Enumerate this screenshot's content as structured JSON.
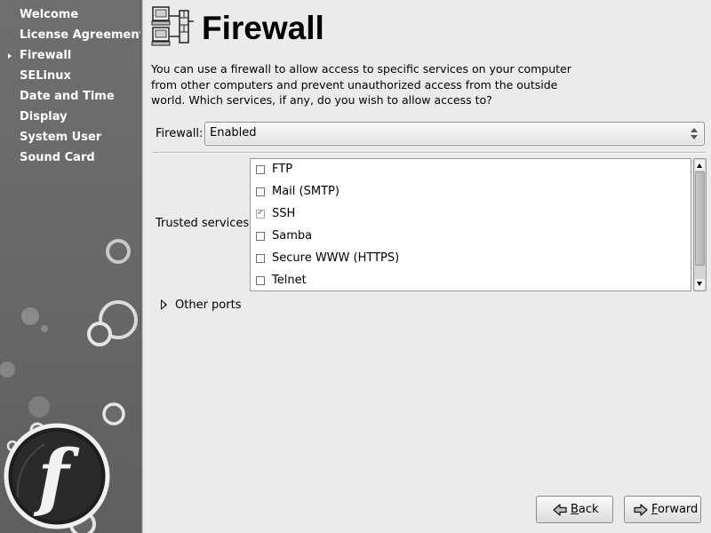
{
  "sidebar": {
    "items": [
      {
        "label": "Welcome",
        "current": false
      },
      {
        "label": "License Agreement",
        "current": false
      },
      {
        "label": "Firewall",
        "current": true
      },
      {
        "label": "SELinux",
        "current": false
      },
      {
        "label": "Date and Time",
        "current": false
      },
      {
        "label": "Display",
        "current": false
      },
      {
        "label": "System User",
        "current": false
      },
      {
        "label": "Sound Card",
        "current": false
      }
    ],
    "logo": "fedora-logo",
    "logo_letter": "f"
  },
  "header": {
    "title": "Firewall",
    "icon": "firewall-network-icon"
  },
  "main": {
    "description": "You can use a firewall to allow access to specific services on your computer from other computers and prevent unauthorized access from the outside world.  Which services, if any, do you wish to allow access to?",
    "firewall": {
      "label": "Firewall:",
      "value": "Enabled"
    },
    "trusted": {
      "label": "Trusted services:",
      "services": [
        {
          "label": "FTP",
          "checked": false
        },
        {
          "label": "Mail (SMTP)",
          "checked": false
        },
        {
          "label": "SSH",
          "checked": true
        },
        {
          "label": "Samba",
          "checked": false
        },
        {
          "label": "Secure WWW (HTTPS)",
          "checked": false
        },
        {
          "label": "Telnet",
          "checked": false
        }
      ]
    },
    "other_ports": {
      "label": "Other ports",
      "expanded": false
    }
  },
  "buttons": {
    "back_label": "Back",
    "forward_label": "Forward",
    "back_icon": "arrow-left-icon",
    "forward_icon": "arrow-right-icon"
  },
  "colors": {
    "sidebar_bg": "#6b6b6b",
    "page_bg": "#ebebeb",
    "sidebar_text": "#ffffff"
  }
}
